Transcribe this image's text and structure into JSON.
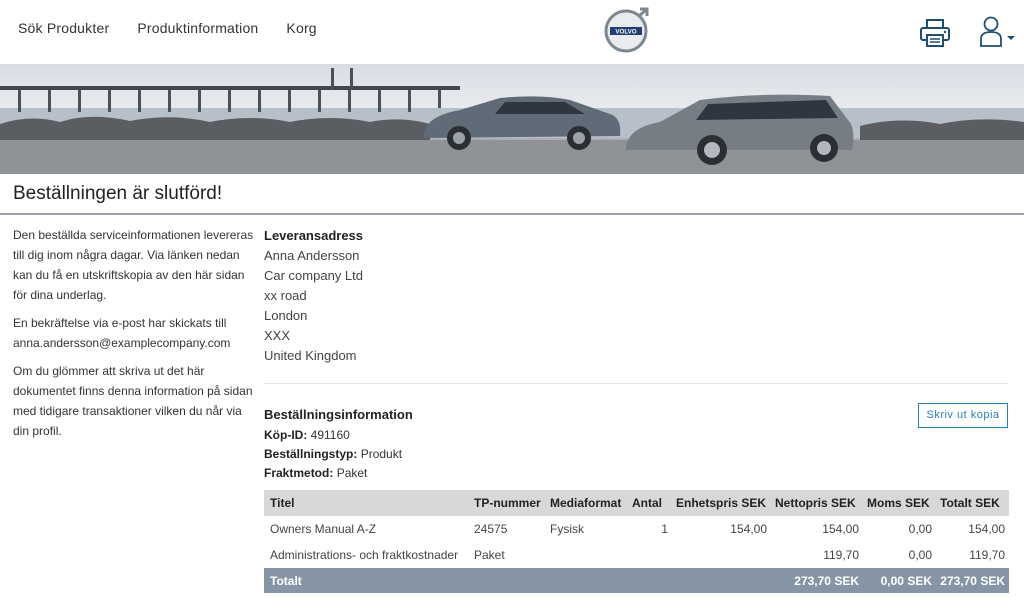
{
  "nav": {
    "items": [
      "Sök Produkter",
      "Produktinformation",
      "Korg"
    ]
  },
  "header": {
    "logo_text": "VOLVO",
    "icons": [
      "printer-icon",
      "user-icon",
      "chevron-down-icon"
    ]
  },
  "page": {
    "title": "Beställningen är slutförd!"
  },
  "intro": {
    "p1": "Den beställda serviceinformationen levereras till dig inom några dagar. Via länken nedan kan du få en utskriftskopia av den här sidan för dina underlag.",
    "p2": "En bekräftelse via e-post har skickats till anna.andersson@examplecompany.com",
    "p3": "Om du glömmer att skriva ut det här dokumentet finns denna information på sidan med tidigare transaktioner vilken du når via din profil."
  },
  "address": {
    "heading": "Leveransadress",
    "lines": [
      "Anna Andersson",
      "Car company Ltd",
      "xx road",
      "London",
      "XXX",
      "United Kingdom"
    ]
  },
  "order": {
    "heading": "Beställningsinformation",
    "id_label": "Köp-ID:",
    "id_value": "491160",
    "type_label": "Beställningstyp:",
    "type_value": "Produkt",
    "shipping_label": "Fraktmetod:",
    "shipping_value": "Paket",
    "print_button": "Skriv ut kopia"
  },
  "table": {
    "headers": [
      "Titel",
      "TP-nummer",
      "Mediaformat",
      "Antal",
      "Enhetspris SEK",
      "Nettopris SEK",
      "Moms SEK",
      "Totalt SEK"
    ],
    "rows": [
      [
        "Owners Manual A-Z",
        "24575",
        "Fysisk",
        "1",
        "154,00",
        "154,00",
        "0,00",
        "154,00"
      ],
      [
        "Administrations- och fraktkostnader",
        "Paket",
        "",
        "",
        "",
        "119,70",
        "0,00",
        "119,70"
      ]
    ],
    "total": [
      "Totalt",
      "",
      "",
      "",
      "",
      "273,70 SEK",
      "0,00 SEK",
      "273,70 SEK"
    ]
  },
  "colors": {
    "accent": "#2a7fb0",
    "table_header": "#d8d8d8",
    "table_total": "#8695a6"
  }
}
